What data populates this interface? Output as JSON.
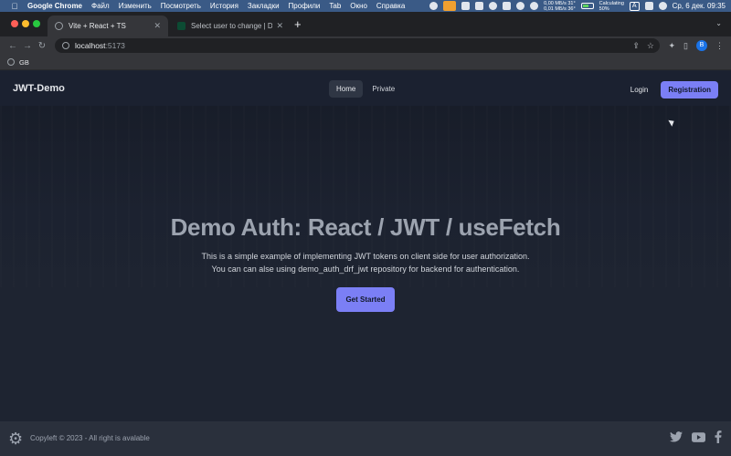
{
  "menubar": {
    "app_name": "Google Chrome",
    "items": [
      "Файл",
      "Изменить",
      "Посмотреть",
      "История",
      "Закладки",
      "Профили",
      "Tab",
      "Окно",
      "Справка"
    ],
    "net_up": "0,00 МБ/s 31°",
    "net_down": "0,01 МБ/s 36°",
    "battery_status": "Calculating",
    "battery_percent": "50%",
    "input_source": "A",
    "datetime": "Ср, 6 дек.  09:35"
  },
  "browser": {
    "tabs": [
      {
        "title": "Vite + React + TS",
        "active": true
      },
      {
        "title": "Select user to change | Djang",
        "active": false
      }
    ],
    "new_tab": "+",
    "url_host": "localhost",
    "url_port": ":5173",
    "profile_initial": "B",
    "bookmarks": [
      {
        "label": "GB"
      }
    ]
  },
  "app": {
    "brand": "JWT-Demo",
    "nav": [
      {
        "label": "Home",
        "active": true
      },
      {
        "label": "Private",
        "active": false
      }
    ],
    "login_label": "Login",
    "register_label": "Registration",
    "hero": {
      "title": "Demo Auth: React / JWT / useFetch",
      "subtitle_line1": "This is a simple example of implementing JWT tokens on client side for user authorization.",
      "subtitle_line2": "You can can alse using demo_auth_drf_jwt repository for backend for authentication.",
      "cta_label": "Get Started"
    },
    "footer": {
      "copyright": "Copyleft © 2023 - All right is avalable",
      "social_icons": [
        "twitter-icon",
        "youtube-icon",
        "facebook-icon"
      ]
    }
  },
  "colors": {
    "accent": "#7b7ff5",
    "page_bg": "#1e2431",
    "footer_bg": "#2a303c"
  }
}
